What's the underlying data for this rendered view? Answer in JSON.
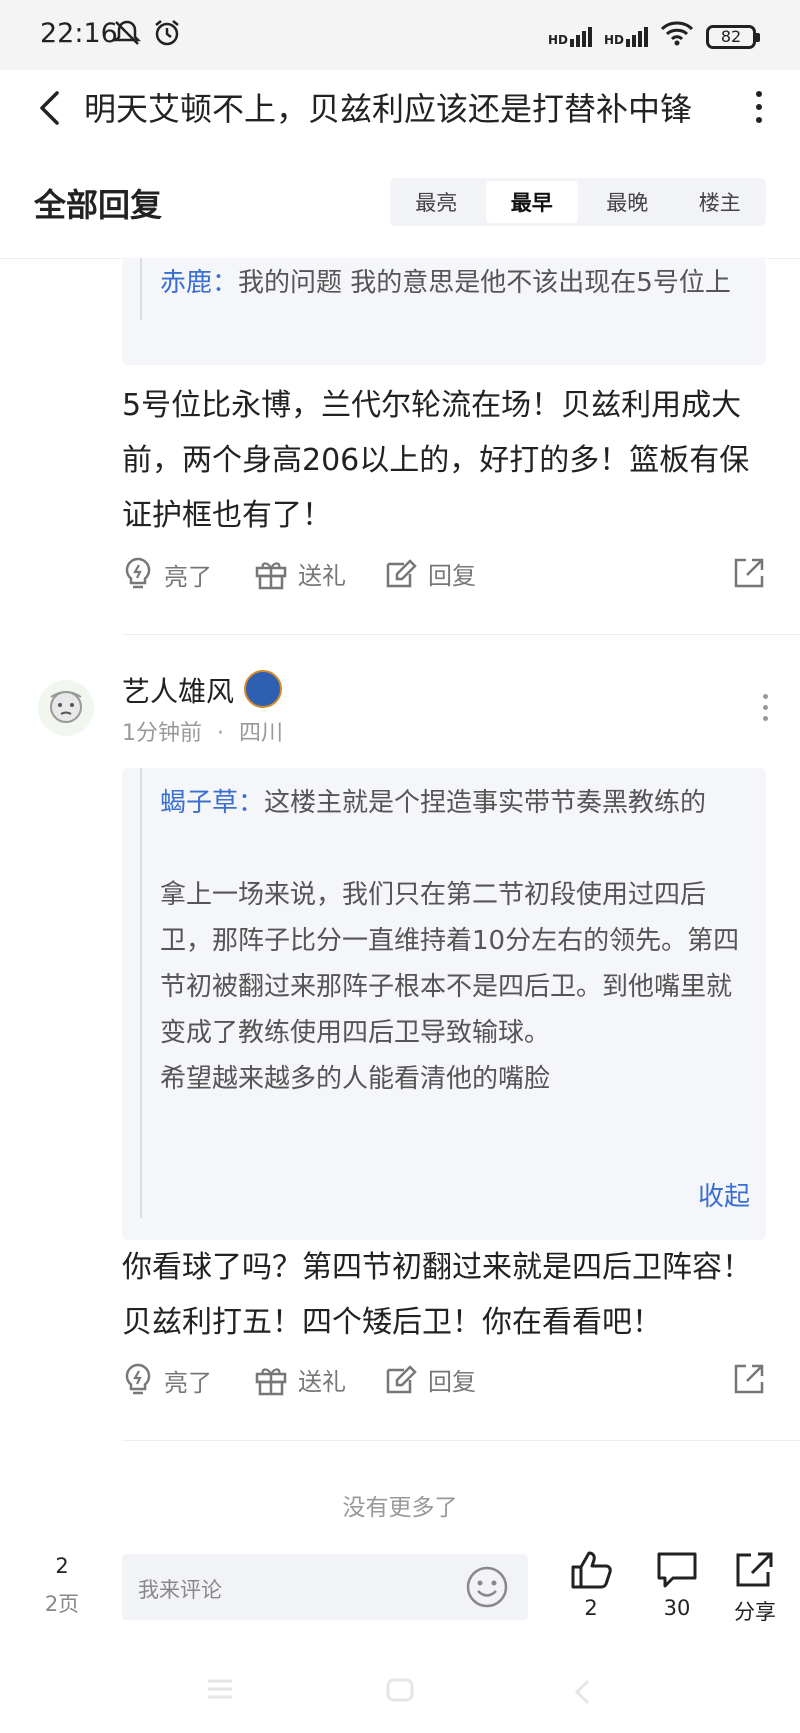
{
  "status": {
    "time": "22:16",
    "battery": "82",
    "hd1": "HD",
    "hd2": "HD"
  },
  "title": "明天艾顿不上，贝兹利应该还是打替补中锋",
  "header": {
    "all_replies": "全部回复",
    "tabs": [
      "最亮",
      "最早",
      "最晚",
      "楼主"
    ],
    "active_tab": "最早"
  },
  "post1": {
    "quote_name": "赤鹿：",
    "quote_text": "我的问题 我的意思是他不该出现在5号位上",
    "reply": "5号位比永博，兰代尔轮流在场！贝兹利用成大前，两个身高206以上的，好打的多！篮板有保证护框也有了！",
    "actions": {
      "light": "亮了",
      "gift": "送礼",
      "reply": "回复"
    }
  },
  "post2": {
    "username": "艺人雄风",
    "time": "1分钟前",
    "separator": "·",
    "location": "四川",
    "quote_name": "蝎子草：",
    "quote_line1": "这楼主就是个捏造事实带节奏黑教练的",
    "quote_para": "拿上一场来说，我们只在第二节初段使用过四后卫，那阵子比分一直维持着10分左右的领先。第四节初被翻过来那阵子根本不是四后卫。到他嘴里就变成了教练使用四后卫导致输球。",
    "quote_last": "希望越来越多的人能看清他的嘴脸",
    "collapse": "收起",
    "reply": "你看球了吗？第四节初翻过来就是四后卫阵容！贝兹利打五！四个矮后卫！你在看看吧！",
    "actions": {
      "light": "亮了",
      "gift": "送礼",
      "reply": "回复"
    }
  },
  "no_more": "没有更多了",
  "bottom": {
    "page": "2",
    "pages": "2页",
    "placeholder": "我来评论",
    "likes": "2",
    "comments": "30",
    "share": "分享"
  }
}
